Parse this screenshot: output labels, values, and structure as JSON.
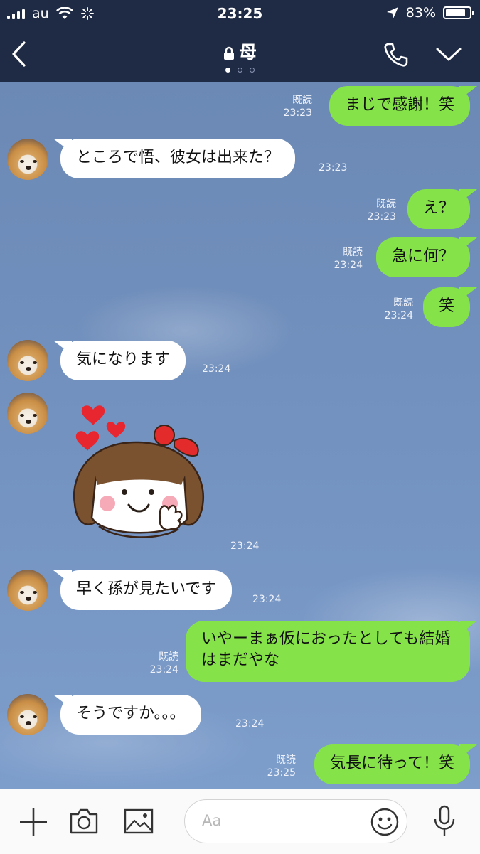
{
  "status_bar": {
    "carrier": "au",
    "time": "23:25",
    "battery_text": "83%",
    "battery_level": 0.83,
    "icons": [
      "signal-icon",
      "wifi-icon",
      "activity-icon",
      "location-arrow-icon",
      "battery-icon"
    ]
  },
  "header": {
    "title": "母",
    "page_indicator": {
      "count": 3,
      "active": 1
    },
    "icons": [
      "back-chevron-icon",
      "lock-icon",
      "phone-icon",
      "chevron-down-icon"
    ]
  },
  "messages": [
    {
      "id": "m1",
      "direction": "out",
      "text": "まじで感謝！笑",
      "read": "既読",
      "time": "23:23"
    },
    {
      "id": "m2",
      "direction": "in",
      "text": "ところで悟、彼女は出来た？",
      "time": "23:23"
    },
    {
      "id": "m3",
      "direction": "out",
      "text": "え？",
      "read": "既読",
      "time": "23:23"
    },
    {
      "id": "m4",
      "direction": "out",
      "text": "急に何？",
      "read": "既読",
      "time": "23:24"
    },
    {
      "id": "m5",
      "direction": "out",
      "text": "笑",
      "read": "既読",
      "time": "23:24"
    },
    {
      "id": "m6",
      "direction": "in",
      "text": "気になります",
      "time": "23:24"
    },
    {
      "id": "m7",
      "direction": "in",
      "type": "sticker",
      "sticker": "girl-with-hearts-sticker",
      "time": "23:24"
    },
    {
      "id": "m8",
      "direction": "in",
      "text": "早く孫が見たいです",
      "time": "23:24"
    },
    {
      "id": "m9",
      "direction": "out",
      "text": "いやーまぁ仮におったとしても結婚はまだやな",
      "read": "既読",
      "time": "23:24"
    },
    {
      "id": "m10",
      "direction": "in",
      "text": "そうですか。。。",
      "time": "23:24"
    },
    {
      "id": "m11",
      "direction": "out",
      "text": "気長に待って！笑",
      "read": "既読",
      "time": "23:25"
    }
  ],
  "input_bar": {
    "placeholder": "Aa",
    "icons": [
      "plus-icon",
      "camera-icon",
      "image-icon",
      "emoji-icon",
      "microphone-icon"
    ]
  },
  "colors": {
    "header_bg": "#1f2a44",
    "chat_bg": "#7594c2",
    "outgoing_bubble": "#85e249",
    "incoming_bubble": "#ffffff"
  }
}
